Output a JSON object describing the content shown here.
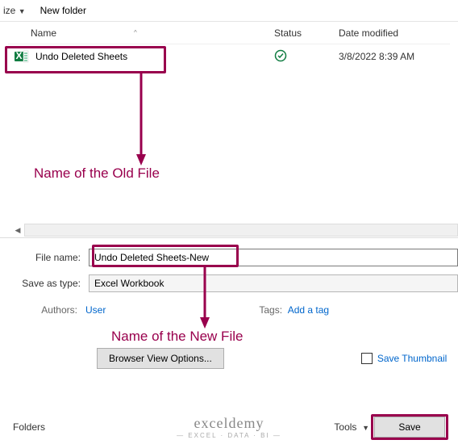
{
  "toolbar": {
    "organize_fragment": "ize",
    "new_folder": "New folder"
  },
  "columns": {
    "name": "Name",
    "status": "Status",
    "date": "Date modified"
  },
  "files": [
    {
      "name": "Undo Deleted Sheets",
      "date": "3/8/2022 8:39 AM"
    }
  ],
  "annotations": {
    "old_file": "Name of the Old File",
    "new_file": "Name of the New File"
  },
  "form": {
    "file_name_label": "File name:",
    "file_name_value": "Undo Deleted Sheets-New",
    "save_type_label": "Save as type:",
    "save_type_value": "Excel Workbook",
    "authors_label": "Authors:",
    "authors_value": "User",
    "tags_label": "Tags:",
    "tags_value": "Add a tag",
    "browser_view": "Browser View Options...",
    "save_thumbnail": "Save Thumbnail"
  },
  "footer": {
    "folders": "Folders",
    "tools": "Tools",
    "save": "Save",
    "watermark_main": "exceldemy",
    "watermark_sub": "— EXCEL · DATA · BI —"
  }
}
